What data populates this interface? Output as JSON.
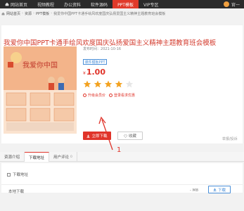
{
  "nav": {
    "items": [
      {
        "label": "网站首页",
        "icon": "home-icon",
        "active": false
      },
      {
        "label": "视频教程",
        "active": false
      },
      {
        "label": "办公资料",
        "active": false
      },
      {
        "label": "软件源码",
        "active": false
      },
      {
        "label": "PPT模板",
        "active": true
      },
      {
        "label": "VIP专区",
        "active": false
      }
    ],
    "user": "官一"
  },
  "breadcrumb": {
    "items": [
      "网站首页",
      "资源",
      "PPT模板",
      "我爱你中国PPT卡通手绘风欢度国庆弘扬爱国主义精神主题教育班会模板"
    ]
  },
  "resource": {
    "title": "我爱你中国PPT卡通手绘风欢度国庆弘扬爱国主义精神主题教育班会模板",
    "date_label": "发布时间：",
    "date": "2021-10-16",
    "tag": "课件模板PPT",
    "currency": "¥",
    "price": "1.00",
    "rating": 4,
    "rating_max": 5,
    "upgrade_link": "升级会员价",
    "vip_link": "登录看求优惠",
    "download_label": "立即下载",
    "favorite_label": "收藏",
    "report_label": "举报/投诉"
  },
  "thumbnail": {
    "headline": "我爱你中国"
  },
  "tabs": [
    "资源介绍",
    "下载地址",
    "用户评论"
  ],
  "tabs_active": 1,
  "tabs_badge": "0",
  "download": {
    "header": "下载地址",
    "row_name": "本地下载",
    "row_size": "- M8",
    "row_button": "下载"
  },
  "annotation": {
    "label": "1"
  },
  "colors": {
    "accent": "#e0342a",
    "nav_bg": "#2b2b2b",
    "link_blue": "#4a8fd8"
  }
}
